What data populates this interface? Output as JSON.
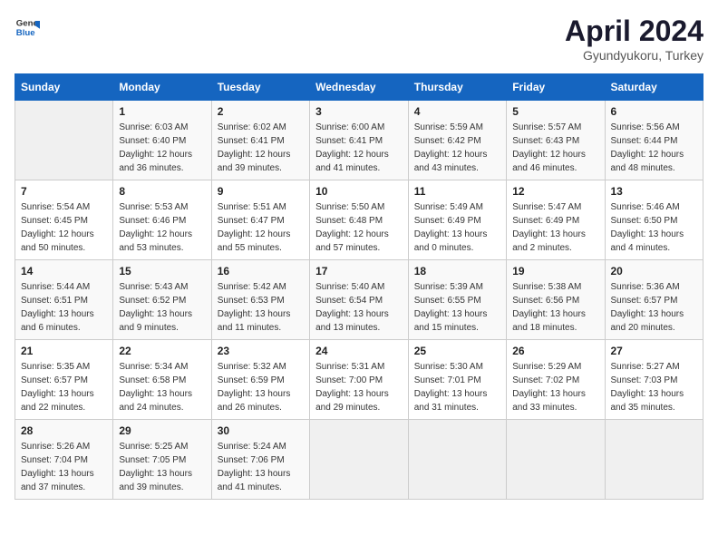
{
  "header": {
    "logo_general": "General",
    "logo_blue": "Blue",
    "title": "April 2024",
    "subtitle": "Gyundyukoru, Turkey"
  },
  "calendar": {
    "days_of_week": [
      "Sunday",
      "Monday",
      "Tuesday",
      "Wednesday",
      "Thursday",
      "Friday",
      "Saturday"
    ],
    "weeks": [
      [
        {
          "day": "",
          "sunrise": "",
          "sunset": "",
          "daylight": "",
          "empty": true
        },
        {
          "day": "1",
          "sunrise": "Sunrise: 6:03 AM",
          "sunset": "Sunset: 6:40 PM",
          "daylight": "Daylight: 12 hours and 36 minutes."
        },
        {
          "day": "2",
          "sunrise": "Sunrise: 6:02 AM",
          "sunset": "Sunset: 6:41 PM",
          "daylight": "Daylight: 12 hours and 39 minutes."
        },
        {
          "day": "3",
          "sunrise": "Sunrise: 6:00 AM",
          "sunset": "Sunset: 6:41 PM",
          "daylight": "Daylight: 12 hours and 41 minutes."
        },
        {
          "day": "4",
          "sunrise": "Sunrise: 5:59 AM",
          "sunset": "Sunset: 6:42 PM",
          "daylight": "Daylight: 12 hours and 43 minutes."
        },
        {
          "day": "5",
          "sunrise": "Sunrise: 5:57 AM",
          "sunset": "Sunset: 6:43 PM",
          "daylight": "Daylight: 12 hours and 46 minutes."
        },
        {
          "day": "6",
          "sunrise": "Sunrise: 5:56 AM",
          "sunset": "Sunset: 6:44 PM",
          "daylight": "Daylight: 12 hours and 48 minutes."
        }
      ],
      [
        {
          "day": "7",
          "sunrise": "Sunrise: 5:54 AM",
          "sunset": "Sunset: 6:45 PM",
          "daylight": "Daylight: 12 hours and 50 minutes."
        },
        {
          "day": "8",
          "sunrise": "Sunrise: 5:53 AM",
          "sunset": "Sunset: 6:46 PM",
          "daylight": "Daylight: 12 hours and 53 minutes."
        },
        {
          "day": "9",
          "sunrise": "Sunrise: 5:51 AM",
          "sunset": "Sunset: 6:47 PM",
          "daylight": "Daylight: 12 hours and 55 minutes."
        },
        {
          "day": "10",
          "sunrise": "Sunrise: 5:50 AM",
          "sunset": "Sunset: 6:48 PM",
          "daylight": "Daylight: 12 hours and 57 minutes."
        },
        {
          "day": "11",
          "sunrise": "Sunrise: 5:49 AM",
          "sunset": "Sunset: 6:49 PM",
          "daylight": "Daylight: 13 hours and 0 minutes."
        },
        {
          "day": "12",
          "sunrise": "Sunrise: 5:47 AM",
          "sunset": "Sunset: 6:49 PM",
          "daylight": "Daylight: 13 hours and 2 minutes."
        },
        {
          "day": "13",
          "sunrise": "Sunrise: 5:46 AM",
          "sunset": "Sunset: 6:50 PM",
          "daylight": "Daylight: 13 hours and 4 minutes."
        }
      ],
      [
        {
          "day": "14",
          "sunrise": "Sunrise: 5:44 AM",
          "sunset": "Sunset: 6:51 PM",
          "daylight": "Daylight: 13 hours and 6 minutes."
        },
        {
          "day": "15",
          "sunrise": "Sunrise: 5:43 AM",
          "sunset": "Sunset: 6:52 PM",
          "daylight": "Daylight: 13 hours and 9 minutes."
        },
        {
          "day": "16",
          "sunrise": "Sunrise: 5:42 AM",
          "sunset": "Sunset: 6:53 PM",
          "daylight": "Daylight: 13 hours and 11 minutes."
        },
        {
          "day": "17",
          "sunrise": "Sunrise: 5:40 AM",
          "sunset": "Sunset: 6:54 PM",
          "daylight": "Daylight: 13 hours and 13 minutes."
        },
        {
          "day": "18",
          "sunrise": "Sunrise: 5:39 AM",
          "sunset": "Sunset: 6:55 PM",
          "daylight": "Daylight: 13 hours and 15 minutes."
        },
        {
          "day": "19",
          "sunrise": "Sunrise: 5:38 AM",
          "sunset": "Sunset: 6:56 PM",
          "daylight": "Daylight: 13 hours and 18 minutes."
        },
        {
          "day": "20",
          "sunrise": "Sunrise: 5:36 AM",
          "sunset": "Sunset: 6:57 PM",
          "daylight": "Daylight: 13 hours and 20 minutes."
        }
      ],
      [
        {
          "day": "21",
          "sunrise": "Sunrise: 5:35 AM",
          "sunset": "Sunset: 6:57 PM",
          "daylight": "Daylight: 13 hours and 22 minutes."
        },
        {
          "day": "22",
          "sunrise": "Sunrise: 5:34 AM",
          "sunset": "Sunset: 6:58 PM",
          "daylight": "Daylight: 13 hours and 24 minutes."
        },
        {
          "day": "23",
          "sunrise": "Sunrise: 5:32 AM",
          "sunset": "Sunset: 6:59 PM",
          "daylight": "Daylight: 13 hours and 26 minutes."
        },
        {
          "day": "24",
          "sunrise": "Sunrise: 5:31 AM",
          "sunset": "Sunset: 7:00 PM",
          "daylight": "Daylight: 13 hours and 29 minutes."
        },
        {
          "day": "25",
          "sunrise": "Sunrise: 5:30 AM",
          "sunset": "Sunset: 7:01 PM",
          "daylight": "Daylight: 13 hours and 31 minutes."
        },
        {
          "day": "26",
          "sunrise": "Sunrise: 5:29 AM",
          "sunset": "Sunset: 7:02 PM",
          "daylight": "Daylight: 13 hours and 33 minutes."
        },
        {
          "day": "27",
          "sunrise": "Sunrise: 5:27 AM",
          "sunset": "Sunset: 7:03 PM",
          "daylight": "Daylight: 13 hours and 35 minutes."
        }
      ],
      [
        {
          "day": "28",
          "sunrise": "Sunrise: 5:26 AM",
          "sunset": "Sunset: 7:04 PM",
          "daylight": "Daylight: 13 hours and 37 minutes."
        },
        {
          "day": "29",
          "sunrise": "Sunrise: 5:25 AM",
          "sunset": "Sunset: 7:05 PM",
          "daylight": "Daylight: 13 hours and 39 minutes."
        },
        {
          "day": "30",
          "sunrise": "Sunrise: 5:24 AM",
          "sunset": "Sunset: 7:06 PM",
          "daylight": "Daylight: 13 hours and 41 minutes."
        },
        {
          "day": "",
          "sunrise": "",
          "sunset": "",
          "daylight": "",
          "empty": true
        },
        {
          "day": "",
          "sunrise": "",
          "sunset": "",
          "daylight": "",
          "empty": true
        },
        {
          "day": "",
          "sunrise": "",
          "sunset": "",
          "daylight": "",
          "empty": true
        },
        {
          "day": "",
          "sunrise": "",
          "sunset": "",
          "daylight": "",
          "empty": true
        }
      ]
    ]
  }
}
